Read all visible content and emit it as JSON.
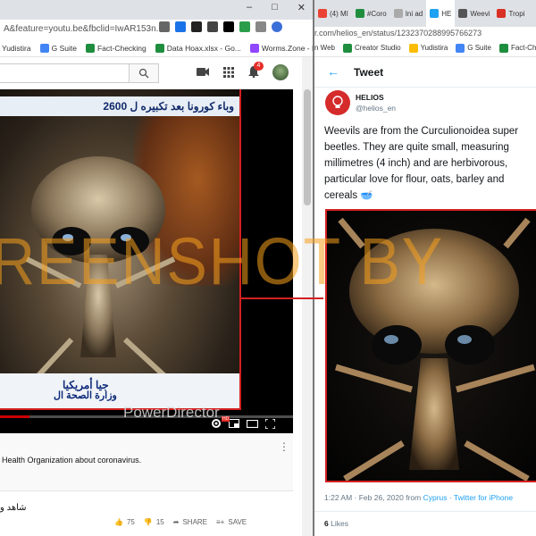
{
  "left_window": {
    "address": "A&feature=youtu.be&fbclid=IwAR153n...",
    "window_controls": [
      "–",
      "□",
      "✕"
    ],
    "bookmarks": [
      "Yudistira",
      "G Suite",
      "Fact-Checking",
      "Data Hoax.xlsx - Go...",
      "Worms.Zone - Play..."
    ],
    "notification_count": "4",
    "video": {
      "arabic_top": "وباء كورونا بعد تكبيره ل 2600",
      "arabic_bottom_1": "وزارة الصحة ال",
      "arabic_bottom_2": "جيا أمريكيا",
      "watermark_text": "PowerDirector",
      "progress": 0.1
    },
    "info_text": "Health Organization about coronavirus.",
    "arabic_caption": "شاهد و",
    "actions": {
      "likes": "75",
      "dislikes": "15",
      "share": "SHARE",
      "save": "SAVE"
    }
  },
  "right_window": {
    "tabs": [
      "(4) MI",
      "#Coro",
      "Ini ad",
      "HE",
      "Weevi",
      "Tropi"
    ],
    "address": "r.com/helios_en/status/1232370288995766273",
    "bookmarks": [
      "n Web",
      "Creator Studio",
      "Yudistira",
      "G Suite",
      "Fact-Checking"
    ],
    "header_title": "Tweet",
    "author_name": "HELIOS",
    "author_handle": "@helios_en",
    "tweet_lines": [
      "Weevils are from the Curculionoidea super",
      "beetles. They are quite small, measuring",
      "millimetres (4 inch) and are herbivorous,",
      "particular love for flour, oats, barley and",
      "cereals 🥣"
    ],
    "meta_time": "1:22 AM · Feb 26, 2020 from",
    "meta_place": "Cyprus",
    "meta_sep": " · ",
    "meta_client": "Twitter for iPhone",
    "likes_count": "6",
    "likes_label": "Likes"
  },
  "overlay": {
    "watermark": "REENSHOT BY"
  }
}
